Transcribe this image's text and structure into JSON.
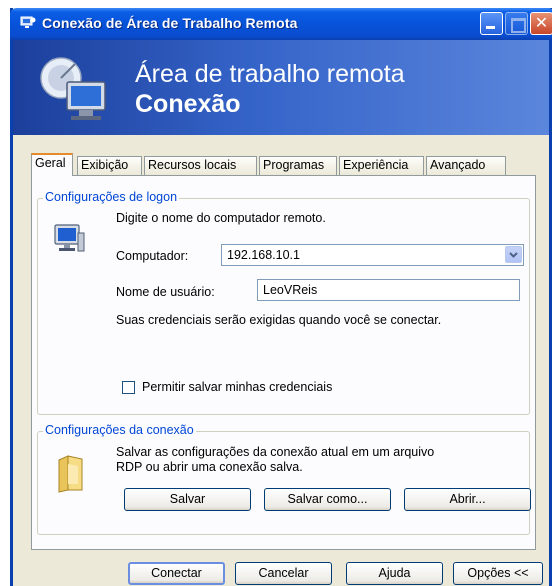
{
  "window": {
    "title": "Conexão de Área de Trabalho Remota"
  },
  "banner": {
    "line1": "Área de trabalho remota",
    "line2": "Conexão"
  },
  "tabs": [
    {
      "label": "Geral",
      "active": true
    },
    {
      "label": "Exibição"
    },
    {
      "label": "Recursos locais"
    },
    {
      "label": "Programas"
    },
    {
      "label": "Experiência"
    },
    {
      "label": "Avançado"
    }
  ],
  "logon": {
    "legend": "Configurações de logon",
    "instruction": "Digite o nome do computador remoto.",
    "computer_label": "Computador:",
    "computer_value": "192.168.10.1",
    "username_label": "Nome de usuário:",
    "username_value": "LeoVReis",
    "credentials_note": "Suas credenciais serão exigidas quando você se conectar.",
    "save_credentials_label": "Permitir salvar minhas credenciais",
    "save_credentials_checked": false
  },
  "connection": {
    "legend": "Configurações da conexão",
    "description_line1": "Salvar as configurações da conexão atual em um arquivo",
    "description_line2": "RDP ou abrir uma conexão salva.",
    "save_label": "Salvar",
    "save_as_label": "Salvar como...",
    "open_label": "Abrir..."
  },
  "footer": {
    "connect_label": "Conectar",
    "cancel_label": "Cancelar",
    "help_label": "Ajuda",
    "options_label": "Opções <<"
  },
  "icons": {
    "app": "remote-desktop-icon",
    "banner": "monitor-satellite-icon",
    "computer": "computer-icon",
    "folder": "folder-icon",
    "dropdown": "chevron-down-icon"
  },
  "colors": {
    "titlebar": "#0653d9",
    "banner": "#3564c9",
    "legend": "#0046d5",
    "window_bg": "#ece9d8"
  }
}
